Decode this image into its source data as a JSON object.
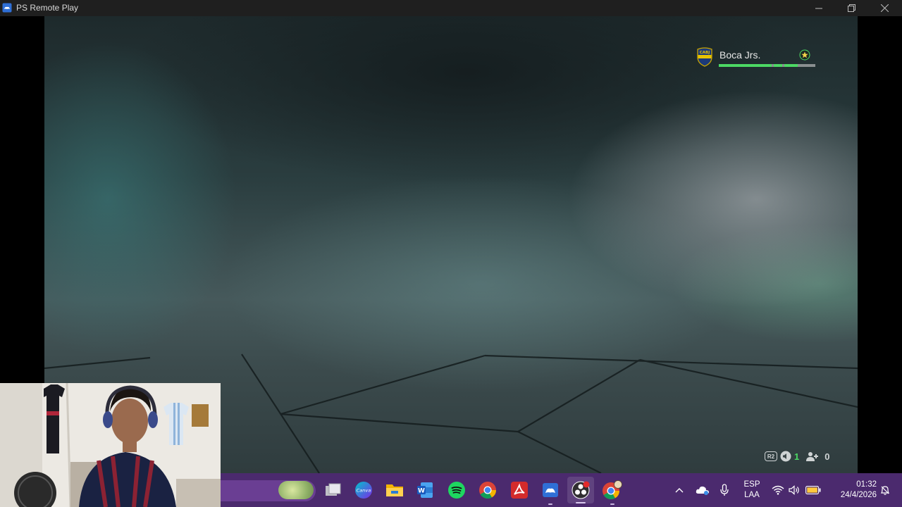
{
  "window": {
    "title": "PS Remote Play",
    "icon": "ps-remote-play-icon",
    "controls": [
      "minimize",
      "maximize",
      "close"
    ]
  },
  "game": {
    "team": {
      "name": "Boca Jrs.",
      "crest_label": "CABJ",
      "crest_icon": "boca-crest-icon",
      "badge_icon": "star-badge-icon",
      "progress": 0.82
    },
    "hud_bottom": {
      "button_label": "R2",
      "green_count": "1",
      "players_count": "0"
    },
    "colors": {
      "accent_green": "#4cd964",
      "team_text": "#e6e6e6"
    }
  },
  "taskbar": {
    "background": "#4b2a6e",
    "apps": [
      {
        "name": "Task View",
        "icon": "task-view-icon"
      },
      {
        "name": "Canva",
        "icon": "canva-icon",
        "label": "Canva"
      },
      {
        "name": "File Explorer",
        "icon": "folder-icon"
      },
      {
        "name": "Word",
        "icon": "word-icon",
        "label": "W"
      },
      {
        "name": "Spotify",
        "icon": "spotify-icon"
      },
      {
        "name": "Chrome",
        "icon": "chrome-icon"
      },
      {
        "name": "Adobe Acrobat",
        "icon": "acrobat-icon"
      },
      {
        "name": "PS Remote Play",
        "icon": "ps-remote-play-icon"
      },
      {
        "name": "OBS Studio",
        "icon": "obs-icon"
      },
      {
        "name": "Chrome Profile",
        "icon": "chrome-profile-icon"
      }
    ],
    "tray": {
      "language": "ESP",
      "layout": "LAA",
      "time": "01:32",
      "date": "24/4/2026"
    }
  }
}
